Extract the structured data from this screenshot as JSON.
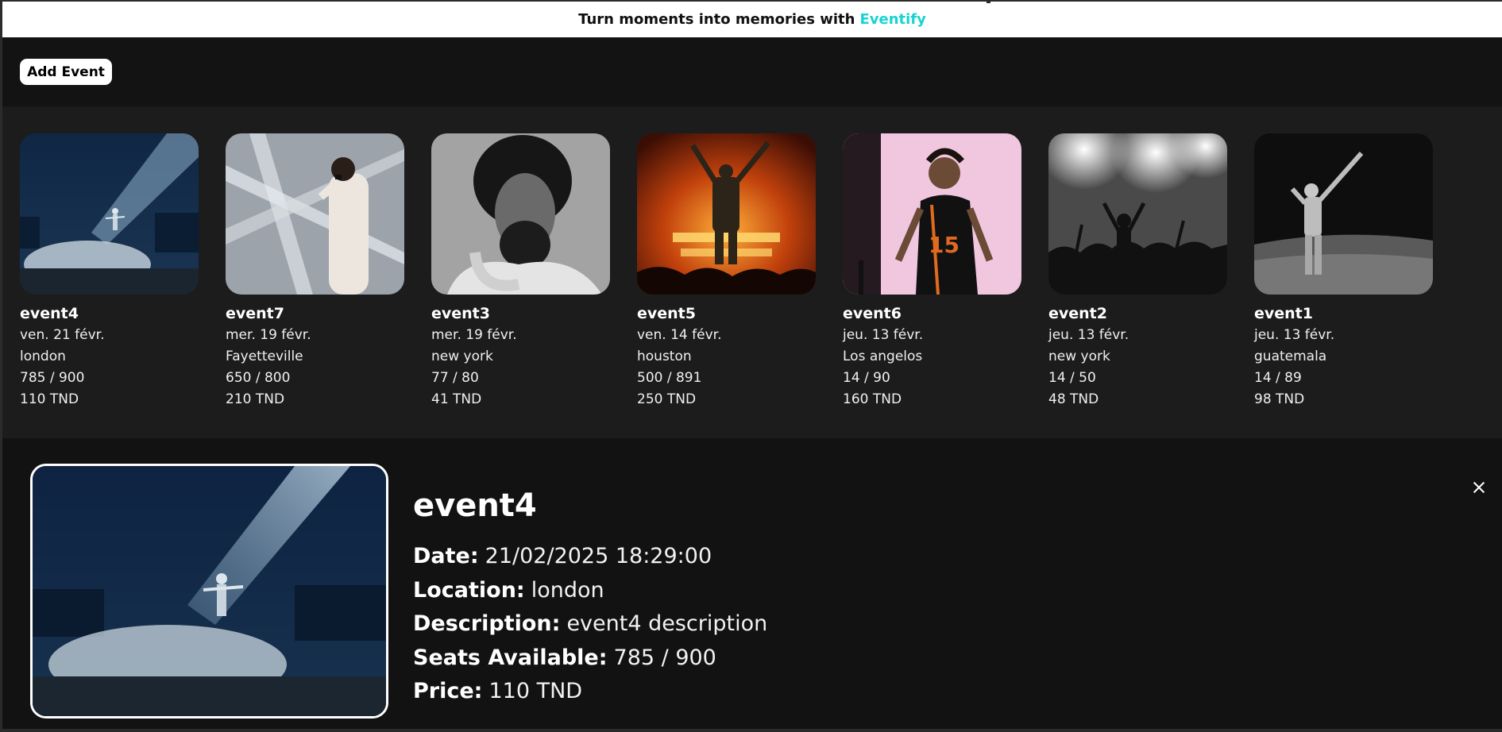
{
  "banner": {
    "text": "Turn moments into memories with",
    "brand": "Eventify",
    "brand_color": "#19d3d3"
  },
  "toolbar": {
    "add_label": "Add Event"
  },
  "events": [
    {
      "name": "event4",
      "date": "ven. 21 févr.",
      "location": "london",
      "seats": "785 / 900",
      "price": "110 TND",
      "image": "performer-in-spotlight-blue"
    },
    {
      "name": "event7",
      "date": "mer. 19 févr.",
      "location": "Fayetteville",
      "seats": "650 / 800",
      "price": "210 TND",
      "image": "rapper-with-microphone-white"
    },
    {
      "name": "event3",
      "date": "mer. 19 févr.",
      "location": "new york",
      "seats": "77 / 80",
      "price": "41 TND",
      "image": "portrait-grayscale"
    },
    {
      "name": "event5",
      "date": "ven. 14 févr.",
      "location": "houston",
      "seats": "500 / 891",
      "price": "250 TND",
      "image": "performer-fire-stage"
    },
    {
      "name": "event6",
      "date": "jeu. 13 févr.",
      "location": "Los angelos",
      "seats": "14 / 90",
      "price": "160 TND",
      "image": "performer-jersey-pink"
    },
    {
      "name": "event2",
      "date": "jeu. 13 févr.",
      "location": "new york",
      "seats": "14 / 50",
      "price": "48 TND",
      "image": "concert-crowd-grayscale"
    },
    {
      "name": "event1",
      "date": "jeu. 13 févr.",
      "location": "guatemala",
      "seats": "14 / 89",
      "price": "98 TND",
      "image": "performer-stadium-grayscale"
    }
  ],
  "detail": {
    "title": "event4",
    "rows": [
      {
        "label": "Date:",
        "value": "21/02/2025 18:29:00"
      },
      {
        "label": "Location:",
        "value": "london"
      },
      {
        "label": "Description:",
        "value": "event4 description"
      },
      {
        "label": "Seats Available:",
        "value": "785 / 900"
      },
      {
        "label": "Price:",
        "value": "110 TND"
      }
    ],
    "close_icon": "close-icon"
  }
}
